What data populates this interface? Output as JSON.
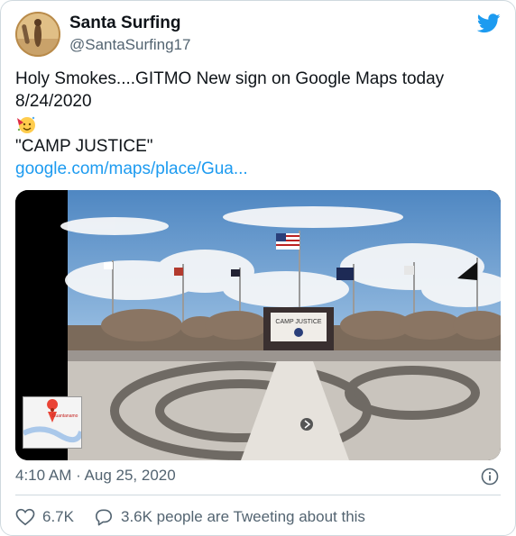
{
  "author": {
    "name": "Santa Surfing",
    "handle": "@SantaSurfing17"
  },
  "tweet": {
    "line1": "Holy Smokes....GITMO New sign on Google Maps today",
    "line2": "8/24/2020",
    "quote": "\"CAMP JUSTICE\"",
    "link": "google.com/maps/place/Gua..."
  },
  "media": {
    "sign_text": "CAMP JUSTICE",
    "map_thumb_label": "Guantanamo"
  },
  "meta": {
    "timestamp": "4:10 AM · Aug 25, 2020"
  },
  "actions": {
    "likes": "6.7K",
    "conversation": "3.6K people are Tweeting about this"
  },
  "colors": {
    "link": "#1d9bf0",
    "secondary": "#536471",
    "like_icon": "#536471"
  }
}
